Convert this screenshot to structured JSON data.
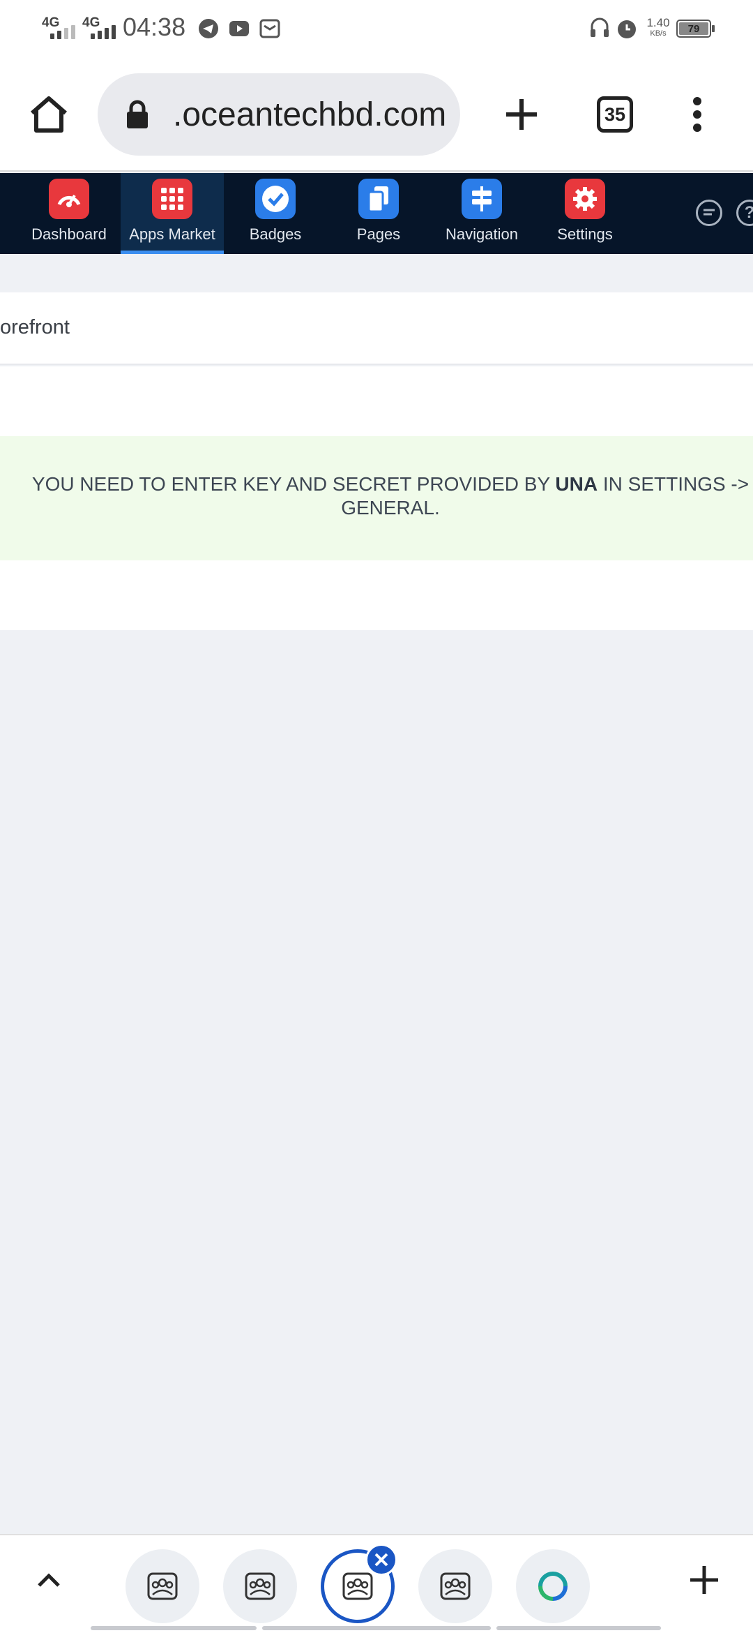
{
  "status_bar": {
    "network_1": "4G",
    "network_2": "4G",
    "time": "04:38",
    "speed_value": "1.40",
    "speed_unit": "KB/s",
    "battery": "79",
    "icons": [
      "telegram-icon",
      "youtube-icon",
      "mail-icon",
      "headphones-icon",
      "alarm-icon"
    ]
  },
  "browser": {
    "url": ".oceantechbd.com",
    "tab_count": "35",
    "icons": [
      "home-icon",
      "lock-icon",
      "new-tab-plus-icon",
      "menu-dots-icon"
    ]
  },
  "admin_nav": {
    "items": [
      {
        "label": "Dashboard",
        "icon": "gauge-icon",
        "color": "#e8383d",
        "active": false
      },
      {
        "label": "Apps Market",
        "icon": "grid-icon",
        "color": "#e8383d",
        "active": true
      },
      {
        "label": "Badges",
        "icon": "badge-check-icon",
        "color": "#2b7de9",
        "active": false
      },
      {
        "label": "Pages",
        "icon": "pages-icon",
        "color": "#2b7de9",
        "active": false
      },
      {
        "label": "Navigation",
        "icon": "signpost-icon",
        "color": "#2b7de9",
        "active": false
      },
      {
        "label": "Settings",
        "icon": "gear-icon",
        "color": "#e8383d",
        "active": false
      }
    ],
    "right_icons": [
      "chat-icon",
      "help-icon"
    ]
  },
  "content": {
    "storefront_label": "orefront",
    "notice_before": "YOU NEED TO ENTER KEY AND SECRET PROVIDED BY ",
    "notice_bold": "UNA",
    "notice_after": " IN SETTINGS -> GENERAL."
  },
  "colors": {
    "nav_background": "#061529",
    "nav_active": "#0e2c4c",
    "accent": "#3b8ef0",
    "notice_background": "#f0fbea",
    "tab_accent": "#1a56c4"
  }
}
